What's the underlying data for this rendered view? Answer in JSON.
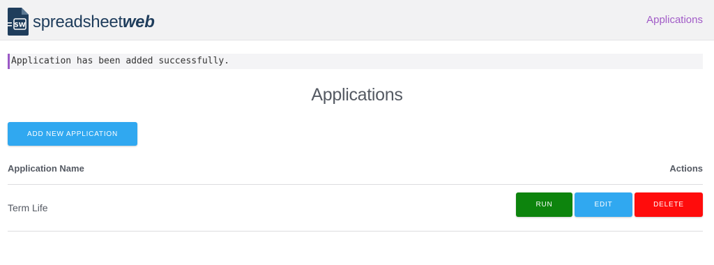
{
  "header": {
    "logo_text_light": "spreadsheet",
    "logo_text_bold": "web",
    "logo_icon_text": "SW",
    "nav_link": "Applications"
  },
  "alert": {
    "message": "Application has been added successfully."
  },
  "main": {
    "title": "Applications",
    "add_button": "ADD NEW APPLICATION",
    "table": {
      "columns": [
        "Application Name",
        "Actions"
      ],
      "rows": [
        {
          "name": "Term Life",
          "actions": [
            "RUN",
            "EDIT",
            "DELETE"
          ]
        }
      ]
    }
  },
  "colors": {
    "brand": "#1f3d5c",
    "accent": "#a15bc7",
    "primary": "#30a8f0",
    "run": "#0d840d",
    "delete": "#ff0c0c"
  },
  "icons": [
    "spreadsheetweb-logo-icon"
  ]
}
